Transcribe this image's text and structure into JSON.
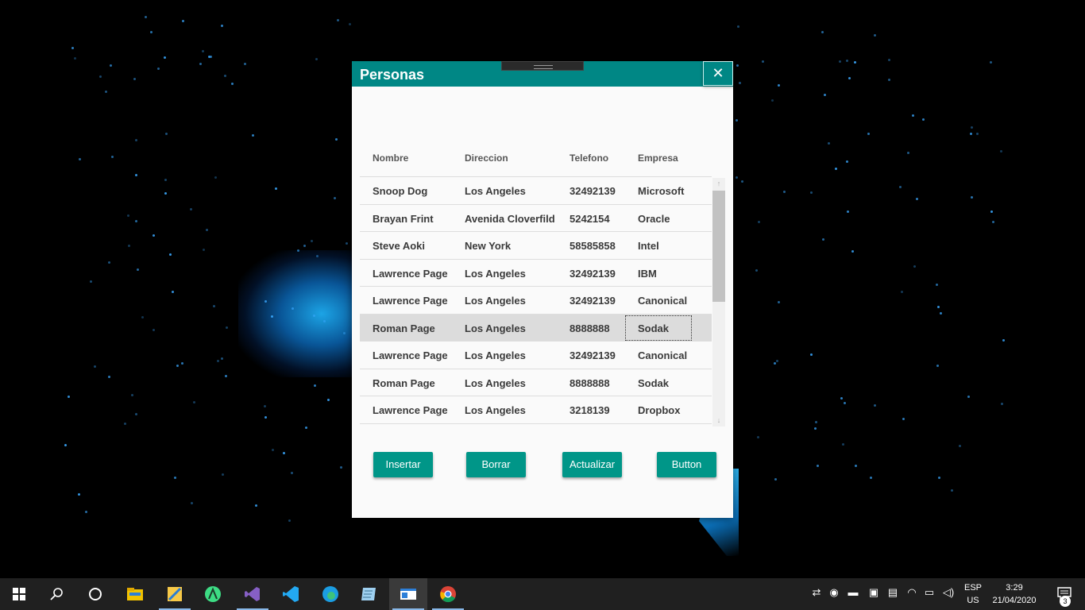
{
  "dialog": {
    "title": "Personas",
    "close_glyph": "✕"
  },
  "table": {
    "headers": [
      "Nombre",
      "Direccion",
      "Telefono",
      "Empresa"
    ],
    "rows": [
      [
        "Snoop Dog",
        "Los Angeles",
        "32492139",
        "Microsoft"
      ],
      [
        "Brayan Frint",
        "Avenida Cloverfild",
        "5242154",
        "Oracle"
      ],
      [
        "Steve Aoki",
        "New York",
        "58585858",
        "Intel"
      ],
      [
        "Lawrence Page",
        "Los Angeles",
        "32492139",
        "IBM"
      ],
      [
        "Lawrence Page",
        "Los Angeles",
        "32492139",
        "Canonical"
      ],
      [
        "Roman Page",
        "Los Angeles",
        "8888888",
        "Sodak"
      ],
      [
        "Lawrence Page",
        "Los Angeles",
        "32492139",
        "Canonical"
      ],
      [
        "Roman Page",
        "Los Angeles",
        "8888888",
        "Sodak"
      ],
      [
        "Lawrence Page",
        "Los Angeles",
        "3218139",
        "Dropbox"
      ]
    ],
    "selected_row": 5
  },
  "buttons": {
    "insert": "Insertar",
    "delete": "Borrar",
    "update": "Actualizar",
    "extra": "Button"
  },
  "taskbar": {
    "language_line1": "ESP",
    "language_line2": "US",
    "time": "3:29",
    "date": "21/04/2020",
    "notification_count": "3"
  },
  "colors": {
    "accent": "#008785",
    "button": "#009688",
    "selected_row": "#dcdcdc"
  }
}
